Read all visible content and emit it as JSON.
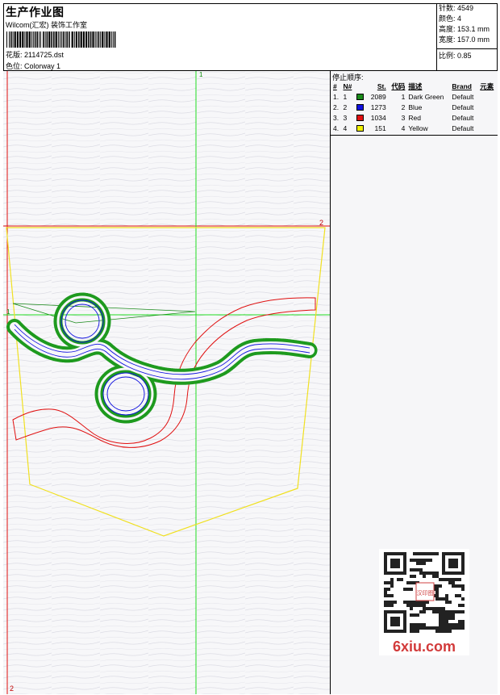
{
  "header": {
    "title": "生产作业图",
    "studio": "Wilcom(汇宏) 装饰工作室",
    "design_label": "花版:",
    "design_value": "2114725.dst",
    "colorway_label": "色位:",
    "colorway_value": "Colorway 1"
  },
  "stats": {
    "stitches_label": "针数:",
    "stitches": "4549",
    "colors_label": "颜色:",
    "colors": "4",
    "height_label": "高度:",
    "height": "153.1 mm",
    "width_label": "宽度:",
    "width": "157.0 mm",
    "scale_label": "比例:",
    "scale": "0.85"
  },
  "canvas": {
    "marker_top": "1",
    "marker_right": "2",
    "marker_left": "1",
    "marker_bottom": "2"
  },
  "stop_sequence": {
    "title": "停止顺序:",
    "columns": [
      "#",
      "N#",
      "St.",
      "代码",
      "描述",
      "Brand",
      "元素"
    ],
    "rows": [
      {
        "idx": "1.",
        "needle": "1",
        "color": "#1a8a1a",
        "stitches": "2089",
        "code": "1",
        "desc": "Dark Green",
        "brand": "Default"
      },
      {
        "idx": "2.",
        "needle": "2",
        "color": "#1010e0",
        "stitches": "1273",
        "code": "2",
        "desc": "Blue",
        "brand": "Default"
      },
      {
        "idx": "3.",
        "needle": "3",
        "color": "#e01010",
        "stitches": "1034",
        "code": "3",
        "desc": "Red",
        "brand": "Default"
      },
      {
        "idx": "4.",
        "needle": "4",
        "color": "#f0f000",
        "stitches": "151",
        "code": "4",
        "desc": "Yellow",
        "brand": "Default"
      }
    ]
  },
  "watermark": {
    "text": "6xiu.com",
    "seal_text": "汉印图"
  }
}
